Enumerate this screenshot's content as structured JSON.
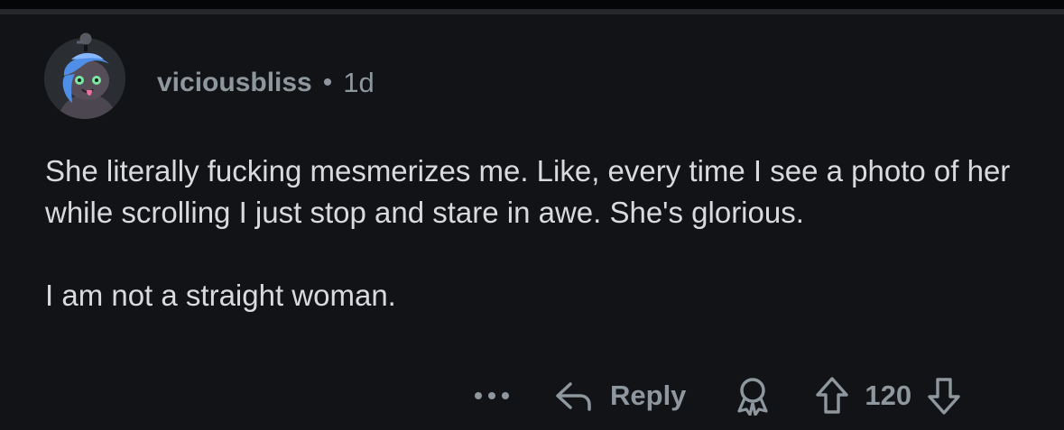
{
  "comment": {
    "author": "viciousbliss",
    "separator": "•",
    "age": "1d",
    "paragraphs": [
      "She literally fucking mesmerizes me. Like, every time I see a photo of her while scrolling I just stop and stare in awe. She's glorious.",
      "I am not a straight woman."
    ]
  },
  "actions": {
    "more_icon": "more-horizontal-icon",
    "reply_icon": "reply-arrow-icon",
    "reply_label": "Reply",
    "award_icon": "award-ribbon-icon",
    "upvote_icon": "arrow-up-icon",
    "score": "120",
    "downvote_icon": "arrow-down-icon"
  },
  "colors": {
    "background": "#111316",
    "text": "#d8dadc",
    "muted": "#8e979e",
    "avatar_hair": "#4f8fe8",
    "avatar_eyes": "#7be7a2"
  }
}
